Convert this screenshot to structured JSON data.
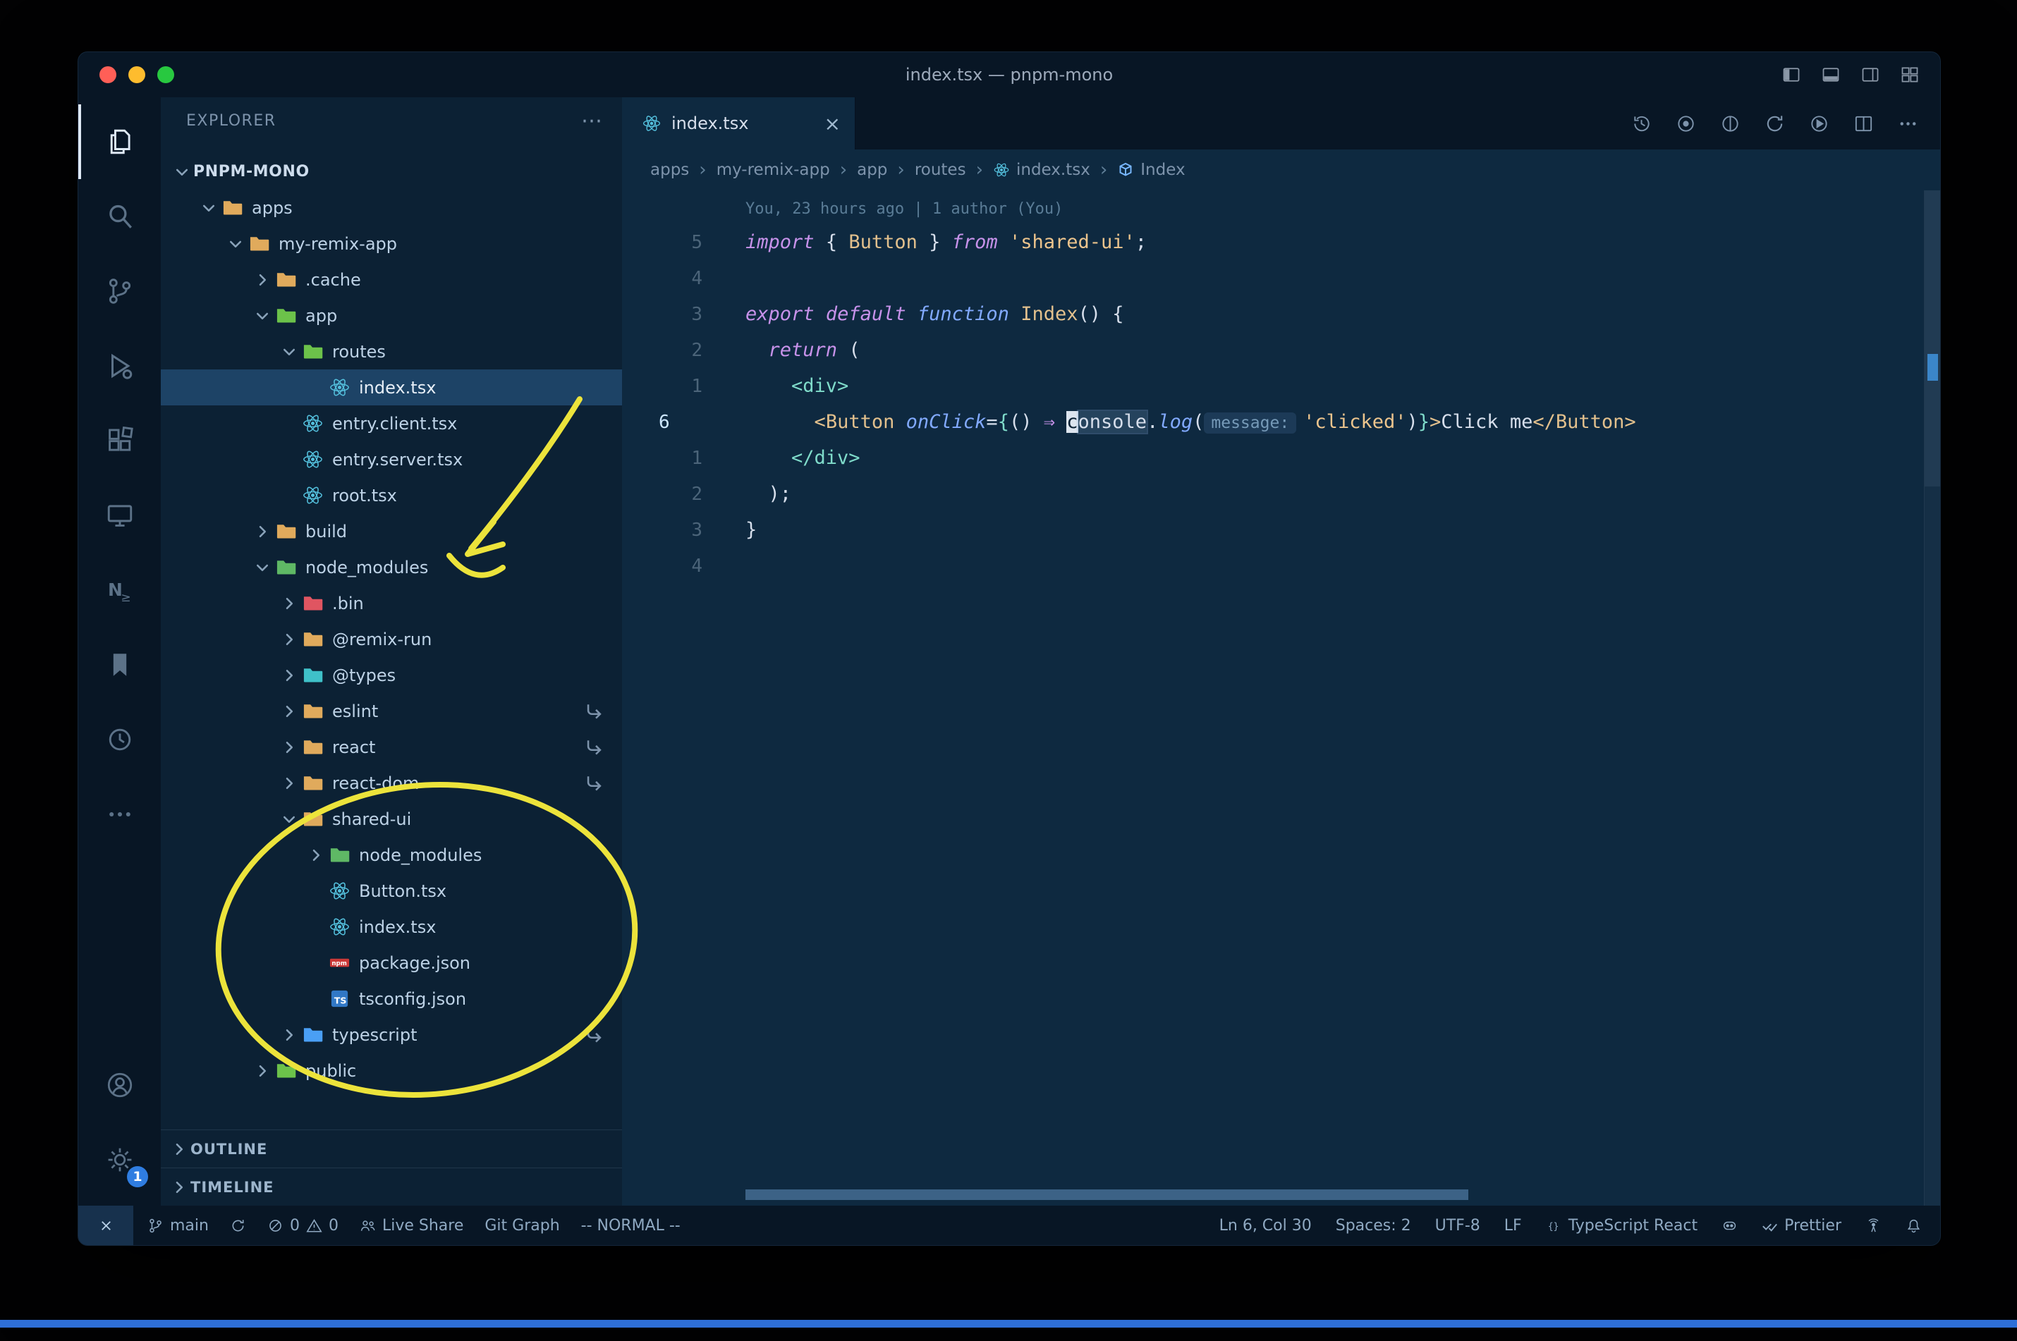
{
  "title_bar": {
    "title": "index.tsx — pnpm-mono",
    "layout_icons": [
      "panel-left",
      "panel-bottom",
      "panel-right",
      "layout-grid"
    ]
  },
  "activity_bar": {
    "items": [
      {
        "name": "explorer",
        "icon": "files",
        "active": true
      },
      {
        "name": "search",
        "icon": "search"
      },
      {
        "name": "source-control",
        "icon": "branch"
      },
      {
        "name": "run-debug",
        "icon": "debug"
      },
      {
        "name": "extensions",
        "icon": "extensions"
      },
      {
        "name": "remote-explorer",
        "icon": "remote"
      },
      {
        "name": "nx-console",
        "icon": "nx"
      },
      {
        "name": "bookmarks",
        "icon": "bookmark"
      },
      {
        "name": "time-tracker",
        "icon": "clockCircle"
      },
      {
        "name": "more-views",
        "icon": "moreDots"
      }
    ],
    "bottom": [
      {
        "name": "accounts",
        "icon": "account"
      },
      {
        "name": "settings",
        "icon": "gear",
        "badge": "1"
      }
    ]
  },
  "sidebar": {
    "title": "EXPLORER",
    "actions_glyph": "⋯",
    "tree": [
      {
        "label": "PNPM-MONO",
        "level": 0,
        "chevron": "down",
        "root": true
      },
      {
        "label": "apps",
        "level": 1,
        "chevron": "down",
        "icon": "folder",
        "color": "folder_tan"
      },
      {
        "label": "my-remix-app",
        "level": 2,
        "chevron": "down",
        "icon": "folder",
        "color": "folder_tan"
      },
      {
        "label": ".cache",
        "level": 3,
        "chevron": "right",
        "icon": "folder",
        "color": "folder_tan"
      },
      {
        "label": "app",
        "level": 3,
        "chevron": "down",
        "icon": "folder",
        "color": "folder_green"
      },
      {
        "label": "routes",
        "level": 4,
        "chevron": "down",
        "icon": "folder",
        "color": "folder_green"
      },
      {
        "label": "index.tsx",
        "level": 5,
        "chevron": null,
        "icon": "react",
        "selected": true
      },
      {
        "label": "entry.client.tsx",
        "level": 4,
        "chevron": null,
        "icon": "react"
      },
      {
        "label": "entry.server.tsx",
        "level": 4,
        "chevron": null,
        "icon": "react"
      },
      {
        "label": "root.tsx",
        "level": 4,
        "chevron": null,
        "icon": "react"
      },
      {
        "label": "build",
        "level": 3,
        "chevron": "right",
        "icon": "folder",
        "color": "folder_tan"
      },
      {
        "label": "node_modules",
        "level": 3,
        "chevron": "down",
        "icon": "folder",
        "color": "folder_node"
      },
      {
        "label": ".bin",
        "level": 4,
        "chevron": "right",
        "icon": "folder",
        "color": "folder_red"
      },
      {
        "label": "@remix-run",
        "level": 4,
        "chevron": "right",
        "icon": "folder",
        "color": "folder_tan"
      },
      {
        "label": "@types",
        "level": 4,
        "chevron": "right",
        "icon": "folder",
        "color": "folder_teal"
      },
      {
        "label": "eslint",
        "level": 4,
        "chevron": "right",
        "icon": "folder",
        "color": "folder_tan",
        "symlink": true
      },
      {
        "label": "react",
        "level": 4,
        "chevron": "right",
        "icon": "folder",
        "color": "folder_tan",
        "symlink": true
      },
      {
        "label": "react-dom",
        "level": 4,
        "chevron": "right",
        "icon": "folder",
        "color": "folder_tan",
        "symlink": true
      },
      {
        "label": "shared-ui",
        "level": 4,
        "chevron": "down",
        "icon": "folder",
        "color": "folder_tan"
      },
      {
        "label": "node_modules",
        "level": 5,
        "chevron": "right",
        "icon": "folder",
        "color": "folder_node"
      },
      {
        "label": "Button.tsx",
        "level": 5,
        "chevron": null,
        "icon": "react"
      },
      {
        "label": "index.tsx",
        "level": 5,
        "chevron": null,
        "icon": "react"
      },
      {
        "label": "package.json",
        "level": 5,
        "chevron": null,
        "icon": "npm"
      },
      {
        "label": "tsconfig.json",
        "level": 5,
        "chevron": null,
        "icon": "ts"
      },
      {
        "label": "typescript",
        "level": 4,
        "chevron": "right",
        "icon": "folder",
        "color": "folder_blue",
        "symlink": true
      },
      {
        "label": "public",
        "level": 3,
        "chevron": "right",
        "icon": "folder",
        "color": "folder_green"
      }
    ],
    "sections": [
      "OUTLINE",
      "TIMELINE"
    ]
  },
  "editor": {
    "tab": {
      "label": "index.tsx",
      "close": "×"
    },
    "actions": [
      {
        "name": "file-history",
        "icon": "clock"
      },
      {
        "name": "toggle-blame",
        "icon": "target"
      },
      {
        "name": "compare-changes",
        "icon": "circleLine"
      },
      {
        "name": "open-changes",
        "icon": "sync"
      },
      {
        "name": "run-file",
        "icon": "playCircle"
      },
      {
        "name": "split-editor",
        "icon": "split"
      },
      {
        "name": "more-actions",
        "icon": "moreDots"
      }
    ],
    "breadcrumbs": [
      {
        "label": "apps"
      },
      {
        "label": "my-remix-app"
      },
      {
        "label": "app"
      },
      {
        "label": "routes"
      },
      {
        "label": "index.tsx",
        "icon": "react"
      },
      {
        "label": "Index",
        "icon": "symbol"
      }
    ],
    "code": {
      "blame": "You, 23 hours ago | 1 author (You)",
      "lines": [
        {
          "num": "5",
          "segs": [
            [
              "import",
              "kw"
            ],
            [
              " ",
              "p"
            ],
            [
              "{ ",
              "p"
            ],
            [
              "Button",
              "comp"
            ],
            [
              " }",
              "p"
            ],
            [
              " ",
              "p"
            ],
            [
              "from",
              "kw"
            ],
            [
              " ",
              "p"
            ],
            [
              "'shared-ui'",
              "str"
            ],
            [
              ";",
              "p"
            ]
          ]
        },
        {
          "num": "4",
          "segs": []
        },
        {
          "num": "3",
          "segs": [
            [
              "export",
              "kw"
            ],
            [
              " ",
              "p"
            ],
            [
              "default",
              "kw"
            ],
            [
              " ",
              "p"
            ],
            [
              "function",
              "fnkw"
            ],
            [
              " ",
              "p"
            ],
            [
              "Index",
              "comp"
            ],
            [
              "() {",
              "p"
            ]
          ]
        },
        {
          "num": "2",
          "segs": [
            [
              "  ",
              "p"
            ],
            [
              "return",
              "kw"
            ],
            [
              " (",
              "p"
            ]
          ]
        },
        {
          "num": "1",
          "segs": [
            [
              "    ",
              "p"
            ],
            [
              "<div>",
              "tag"
            ]
          ]
        },
        {
          "num": "6",
          "current": true,
          "segs": [
            [
              "      ",
              "p"
            ],
            [
              "<",
              "comp"
            ],
            [
              "Button",
              "comp"
            ],
            [
              " ",
              "p"
            ],
            [
              "onClick",
              "attr"
            ],
            [
              "=",
              "p"
            ],
            [
              "{",
              "brace"
            ],
            [
              "() ",
              "p"
            ],
            [
              "⇒",
              "kw"
            ],
            [
              " ",
              "p"
            ],
            [
              "c",
              "cursorblk"
            ],
            [
              "onsole",
              "hl"
            ],
            [
              ".",
              "p"
            ],
            [
              "log",
              "fnkw"
            ],
            [
              "(",
              "p"
            ],
            [
              "message:",
              "hint"
            ],
            [
              "'clicked'",
              "str"
            ],
            [
              ")",
              "p"
            ],
            [
              "}",
              "brace"
            ],
            [
              ">",
              "comp"
            ],
            [
              "Click me",
              "p"
            ],
            [
              "</",
              "comp"
            ],
            [
              "Button",
              "comp"
            ],
            [
              ">",
              "comp"
            ]
          ]
        },
        {
          "num": "1",
          "segs": [
            [
              "    ",
              "p"
            ],
            [
              "</div>",
              "tag"
            ]
          ]
        },
        {
          "num": "2",
          "segs": [
            [
              "  ",
              "p"
            ],
            [
              ");",
              "p"
            ]
          ]
        },
        {
          "num": "3",
          "segs": [
            [
              "}",
              "p"
            ]
          ]
        },
        {
          "num": "4",
          "segs": []
        }
      ]
    }
  },
  "status_bar": {
    "left": [
      {
        "name": "remote-indicator",
        "box": true,
        "parts": [
          {
            "icon": "xremote"
          }
        ]
      },
      {
        "name": "git-branch",
        "parts": [
          {
            "icon": "branch"
          },
          {
            "text": "main"
          }
        ]
      },
      {
        "name": "sync-status",
        "parts": [
          {
            "icon": "sync"
          }
        ]
      },
      {
        "name": "problems",
        "parts": [
          {
            "icon": "error"
          },
          {
            "text": "0"
          },
          {
            "icon": "warning"
          },
          {
            "text": "0"
          }
        ]
      },
      {
        "name": "live-share",
        "parts": [
          {
            "icon": "people"
          },
          {
            "text": "Live Share"
          }
        ]
      },
      {
        "name": "git-graph",
        "parts": [
          {
            "text": "Git Graph"
          }
        ]
      },
      {
        "name": "vim-mode",
        "parts": [
          {
            "text": "-- NORMAL --"
          }
        ]
      }
    ],
    "right": [
      {
        "name": "cursor-position",
        "parts": [
          {
            "text": "Ln 6, Col 30"
          }
        ]
      },
      {
        "name": "indentation",
        "parts": [
          {
            "text": "Spaces: 2"
          }
        ]
      },
      {
        "name": "encoding",
        "parts": [
          {
            "text": "UTF-8"
          }
        ]
      },
      {
        "name": "eol",
        "parts": [
          {
            "text": "LF"
          }
        ]
      },
      {
        "name": "language-mode",
        "parts": [
          {
            "icon": "braces"
          },
          {
            "text": "TypeScript React"
          }
        ]
      },
      {
        "name": "copilot",
        "parts": [
          {
            "icon": "copilot"
          }
        ]
      },
      {
        "name": "prettier",
        "parts": [
          {
            "icon": "check2"
          },
          {
            "text": "Prettier"
          }
        ]
      },
      {
        "name": "remote-tower",
        "parts": [
          {
            "icon": "tower"
          }
        ]
      },
      {
        "name": "notifications",
        "parts": [
          {
            "icon": "bell"
          }
        ]
      }
    ]
  },
  "colors": {
    "annotation_yellow": "#ece33b",
    "react_blue": "#54c0dd",
    "npm_red": "#cb3837",
    "ts_blue": "#3178c6",
    "symbol_blue": "#79b8ff",
    "badge_blue": "#2f7de1",
    "folder_tan": "#e0aa5c",
    "folder_green": "#6cc24a",
    "folder_node": "#5fb865",
    "folder_red": "#e05561",
    "folder_teal": "#3fc1c9",
    "folder_blue": "#4a9ff5",
    "traffic_red": "#ff5f57",
    "traffic_yellow": "#febc2e",
    "traffic_green": "#28c840",
    "marker_blue": "#3e8fd6",
    "hscroll_thumb": "#3c6286",
    "bottom_strip_blue": "#2e6fd8"
  }
}
